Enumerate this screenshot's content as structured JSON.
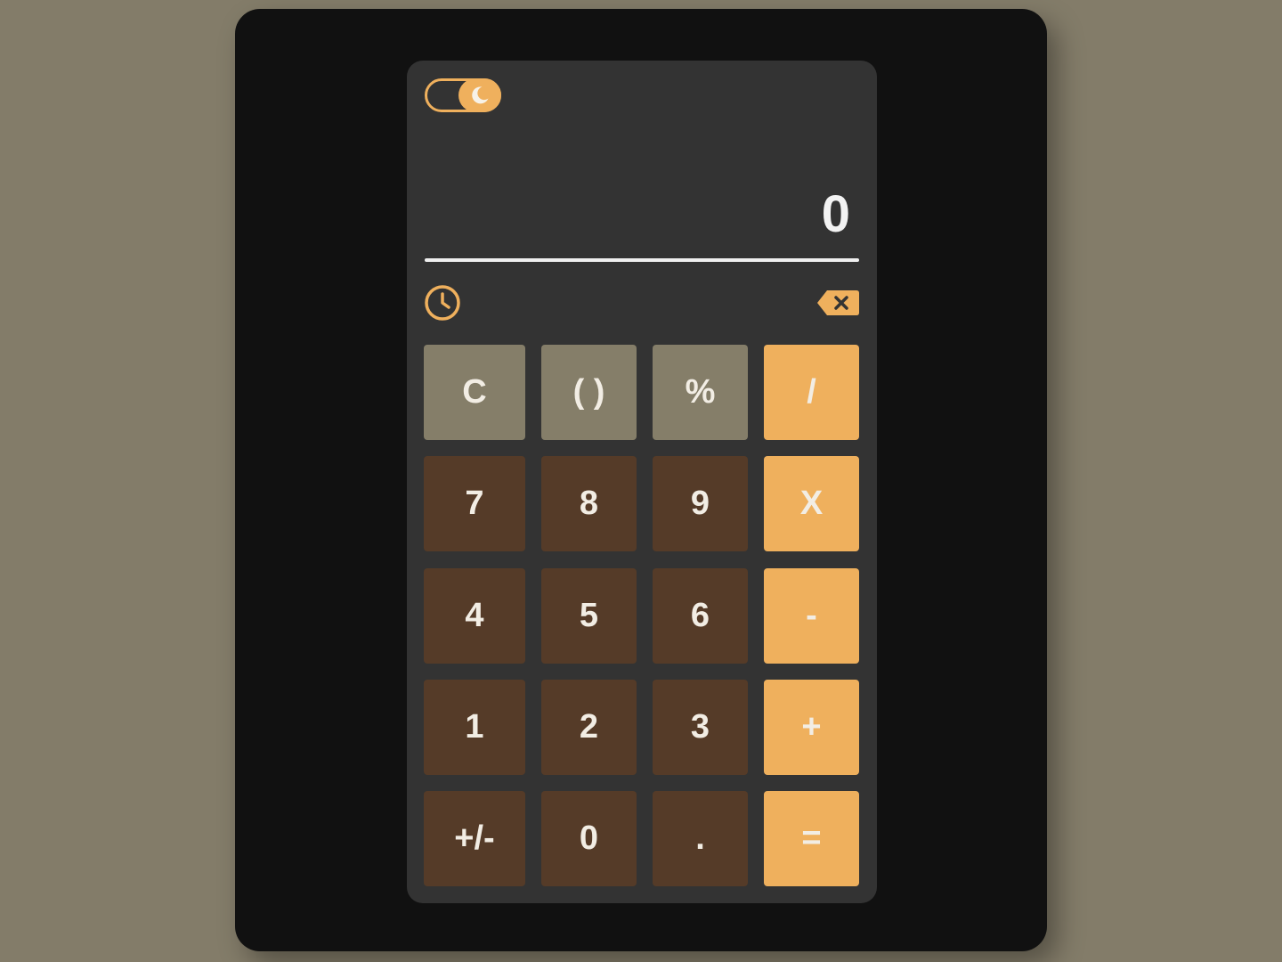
{
  "theme": {
    "page_bg": "#837c69",
    "frame_bg": "#111111",
    "calc_bg": "#333333",
    "accent": "#efb05d",
    "fn_key_bg": "#857e69",
    "num_key_bg": "#553b28",
    "text": "#f2ede4"
  },
  "toggle": {
    "icon": "moon-icon",
    "state": "dark"
  },
  "display": {
    "value": "0"
  },
  "controls": {
    "history_icon": "clock-icon",
    "backspace_icon": "backspace-icon"
  },
  "keys": {
    "row1": [
      "C",
      "( )",
      "%",
      "/"
    ],
    "row2": [
      "7",
      "8",
      "9",
      "X"
    ],
    "row3": [
      "4",
      "5",
      "6",
      "-"
    ],
    "row4": [
      "1",
      "2",
      "3",
      "+"
    ],
    "row5": [
      "+/-",
      "0",
      ".",
      "="
    ]
  }
}
